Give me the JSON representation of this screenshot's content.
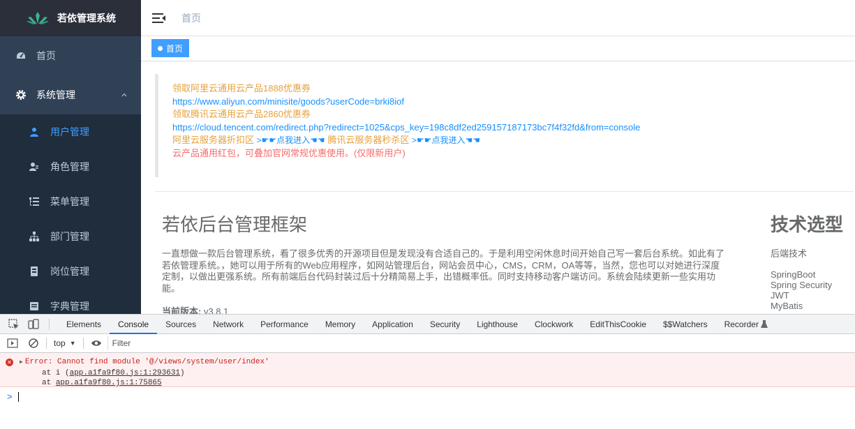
{
  "app": {
    "title": "若依管理系统"
  },
  "sidebar": {
    "items": [
      {
        "label": "首页",
        "icon": "dashboard-icon"
      },
      {
        "label": "系统管理",
        "icon": "gear-icon",
        "expanded": true
      }
    ],
    "sub_items": [
      {
        "label": "用户管理",
        "icon": "user-icon",
        "active": true
      },
      {
        "label": "角色管理",
        "icon": "role-icon"
      },
      {
        "label": "菜单管理",
        "icon": "tree-table-icon"
      },
      {
        "label": "部门管理",
        "icon": "org-tree-icon"
      },
      {
        "label": "岗位管理",
        "icon": "post-icon"
      },
      {
        "label": "字典管理",
        "icon": "dict-icon"
      }
    ],
    "colors": {
      "bg": "#304156",
      "submenu_bg": "#1f2d3d",
      "active": "#409eff"
    }
  },
  "navbar": {
    "breadcrumb": "首页"
  },
  "tags": {
    "active_label": "首页"
  },
  "notice": {
    "line1": "领取阿里云通用云产品1888优惠券",
    "line2": "https://www.aliyun.com/minisite/goods?userCode=brki8iof",
    "line3": "领取腾讯云通用云产品2860优惠券",
    "line4": "https://cloud.tencent.com/redirect.php?redirect=1025&cps_key=198c8df2ed259157187173bc7f4f32fd&from=console",
    "line5a": "阿里云服务器折扣区",
    "line5b": ">☛☛点我进入☚☚",
    "line5c": "腾讯云服务器秒杀区",
    "line5d": ">☛☛点我进入☚☚",
    "line6": "云产品通用红包，可叠加官网常规优惠使用。(仅限新用户)"
  },
  "intro": {
    "title": "若依后台管理框架",
    "description": "一直想做一款后台管理系统，看了很多优秀的开源项目但是发现没有合适自己的。于是利用空闲休息时间开始自己写一套后台系统。如此有了若依管理系统。，她可以用于所有的Web应用程序，如网站管理后台，网站会员中心，CMS，CRM，OA等等，当然，您也可以对她进行深度定制，以做出更强系统。所有前端后台代码封装过后十分精简易上手，出错概率低。同时支持移动客户端访问。系统会陆续更新一些实用功能。",
    "version_label": "当前版本:",
    "version": "v3.8.1"
  },
  "tech": {
    "title": "技术选型",
    "backend_label": "后端技术",
    "items": [
      "SpringBoot",
      "Spring Security",
      "JWT",
      "MyBatis"
    ]
  },
  "devtools": {
    "tabs": [
      "Elements",
      "Console",
      "Sources",
      "Network",
      "Performance",
      "Memory",
      "Application",
      "Security",
      "Lighthouse",
      "Clockwork",
      "EditThisCookie",
      "$$Watchers",
      "Recorder"
    ],
    "active_tab": "Console",
    "context": "top",
    "filter_placeholder": "Filter",
    "error": {
      "message": "Error: Cannot find module '@/views/system/user/index'",
      "stack1_prefix": "at i (",
      "stack1_link": "app.a1fa9f80.js:1:293631",
      "stack1_suffix": ")",
      "stack2_prefix": "at ",
      "stack2_link": "app.a1fa9f80.js:1:75865"
    },
    "prompt": ">"
  }
}
